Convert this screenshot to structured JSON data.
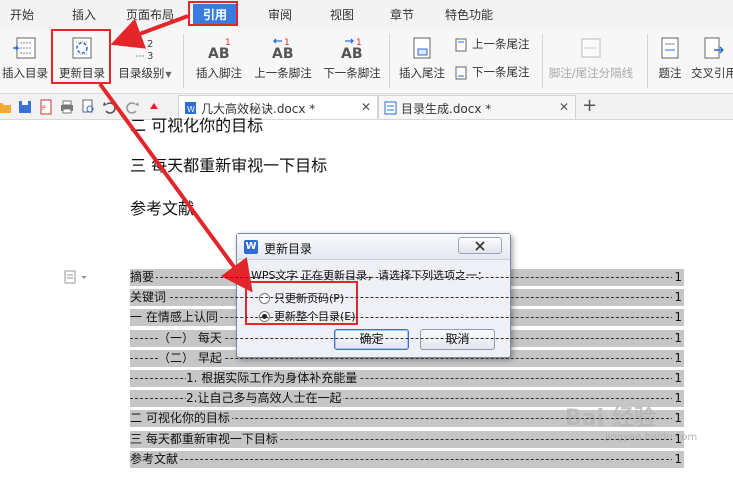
{
  "menu": {
    "tabs": [
      "开始",
      "插入",
      "页面布局",
      "引用",
      "审阅",
      "视图",
      "章节",
      "特色功能"
    ],
    "active_index": 3
  },
  "ribbon": {
    "insert_toc": "插入目录",
    "update_toc": "更新目录",
    "toc_level": "目录级别",
    "insert_footnote": "插入脚注",
    "prev_footnote": "上一条脚注",
    "next_footnote": "下一条脚注",
    "insert_endnote": "插入尾注",
    "prev_endnote": "上一条尾注",
    "next_endnote": "下一条尾注",
    "footnote_separator": "脚注/尾注分隔线",
    "caption": "题注",
    "cross_ref": "交叉引用",
    "icon_ab": "AB",
    "icon_sup": "1"
  },
  "doc_tabs": [
    {
      "title": "几大高效秘诀.docx *"
    },
    {
      "title": "目录生成.docx *"
    }
  ],
  "document": {
    "headings": [
      "二 可视化你的目标",
      "三 每天都重新审视一下目标",
      "参考文献"
    ],
    "toc": [
      {
        "text": "摘要",
        "page": "1"
      },
      {
        "text": "关键词",
        "page": "1"
      },
      {
        "text": "一 在情感上认同",
        "page": "1"
      },
      {
        "text": "（一） 每天",
        "page": "1"
      },
      {
        "text": "（二） 早起",
        "page": "1"
      },
      {
        "text": "1. 根据实际工作为身体补充能量",
        "page": "1"
      },
      {
        "text": "2.让自己多与高效人士在一起",
        "page": "1"
      },
      {
        "text": "二 可视化你的目标",
        "page": "1"
      },
      {
        "text": "三 每天都重新审视一下目标",
        "page": "1"
      },
      {
        "text": "参考文献",
        "page": "1"
      }
    ]
  },
  "dialog": {
    "title": "更新目录",
    "icon_letter": "W",
    "message": "WPS文字 正在更新目录，请选择下列选项之一：",
    "option_page_only": "只更新页码(P)",
    "option_entire": "更新整个目录(E)",
    "selected": "entire",
    "ok": "确定",
    "cancel": "取消"
  },
  "watermark": {
    "brand": "Bai 经验",
    "url": "jingyan.baidu.com"
  },
  "colors": {
    "accent": "#3a7be0",
    "annotation": "#e3262a",
    "toc_highlight": "#c6c6c6"
  }
}
